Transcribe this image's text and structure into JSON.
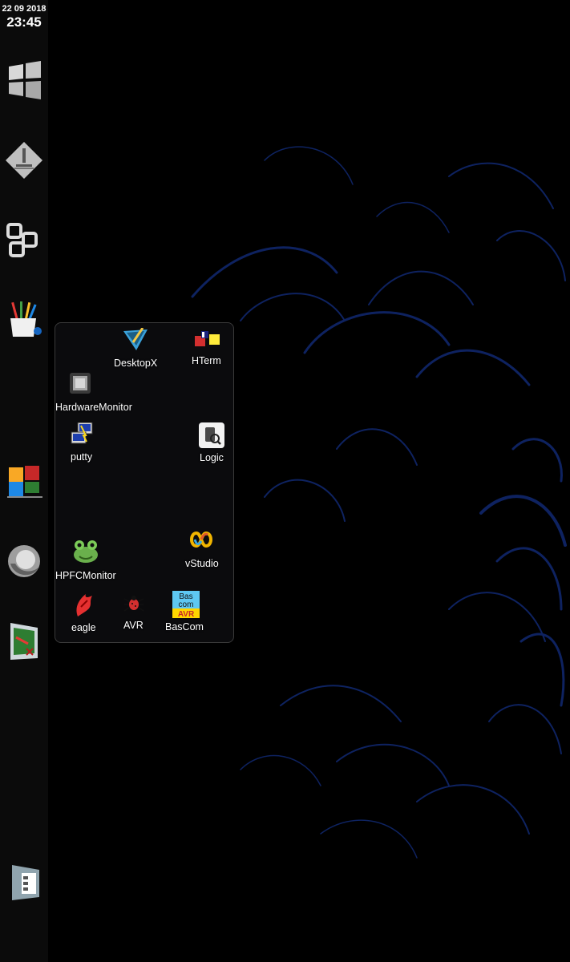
{
  "clock": {
    "date": "22 09 2018",
    "time": "23:45"
  },
  "dock": {
    "items": [
      {
        "icon": "windows-logo-icon"
      },
      {
        "icon": "drill-tool-icon"
      },
      {
        "icon": "cubes-icon"
      },
      {
        "icon": "paint-cup-icon"
      },
      {
        "icon": "puzzle-icon"
      },
      {
        "icon": "firefox-icon"
      },
      {
        "icon": "pcb-tool-icon"
      },
      {
        "icon": "explorer-window-icon"
      }
    ]
  },
  "launcher": {
    "apps": [
      {
        "label": "DesktopX",
        "icon": "desktopx-icon"
      },
      {
        "label": "HTerm",
        "icon": "hterm-icon"
      },
      {
        "label": "HardwareMonitor",
        "icon": "chip-icon"
      },
      {
        "label": "putty",
        "icon": "putty-icon"
      },
      {
        "label": "Logic",
        "icon": "logic-analyzer-icon"
      },
      {
        "label": "vStudio",
        "icon": "visual-studio-icon"
      },
      {
        "label": "HPFCMonitor",
        "icon": "frog-icon"
      },
      {
        "label": "eagle",
        "icon": "eagle-icon"
      },
      {
        "label": "AVR",
        "icon": "avr-bug-icon"
      },
      {
        "label": "BasCom",
        "icon": "bascom-icon"
      }
    ],
    "bascom_logo": [
      "Bas",
      "com",
      "AVR"
    ]
  },
  "colors": {
    "background": "#000000",
    "dock": "#0b0b0b",
    "wallpaper_accent": "#1a3fb0"
  }
}
